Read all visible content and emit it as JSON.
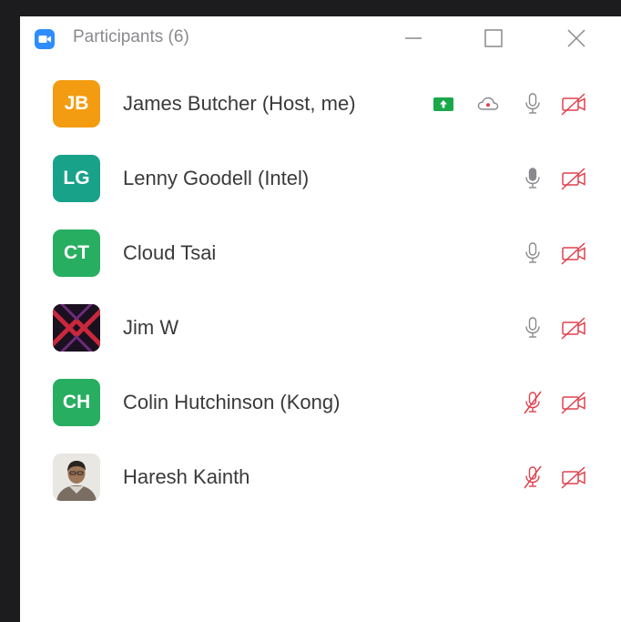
{
  "window": {
    "title": "Participants (6)",
    "controls": [
      "minimize-icon",
      "maximize-icon",
      "close-icon"
    ],
    "accent_color": "#2d8cff"
  },
  "participants": [
    {
      "name": "James Butcher (Host, me)",
      "initials": "JB",
      "avatar_color": "#f39c12",
      "avatar_type": "initials",
      "screen_share": true,
      "cloud_recording": true,
      "mic": "on",
      "video": "off"
    },
    {
      "name": "Lenny Goodell (Intel)",
      "initials": "LG",
      "avatar_color": "#18a28a",
      "avatar_type": "initials",
      "mic": "on-active",
      "video": "off"
    },
    {
      "name": "Cloud Tsai",
      "initials": "CT",
      "avatar_color": "#27ae60",
      "avatar_type": "initials",
      "mic": "on",
      "video": "off"
    },
    {
      "name": "Jim W",
      "initials": "",
      "avatar_type": "pattern-x",
      "mic": "on",
      "video": "off"
    },
    {
      "name": "Colin Hutchinson (Kong)",
      "initials": "CH",
      "avatar_color": "#27ae60",
      "avatar_type": "initials",
      "mic": "off",
      "video": "off"
    },
    {
      "name": "Haresh Kainth",
      "initials": "",
      "avatar_type": "photo",
      "mic": "off",
      "video": "off"
    }
  ],
  "colors": {
    "muted_red": "#e0424e",
    "share_green": "#1aa84a",
    "icon_gray": "#8a8a8e"
  }
}
